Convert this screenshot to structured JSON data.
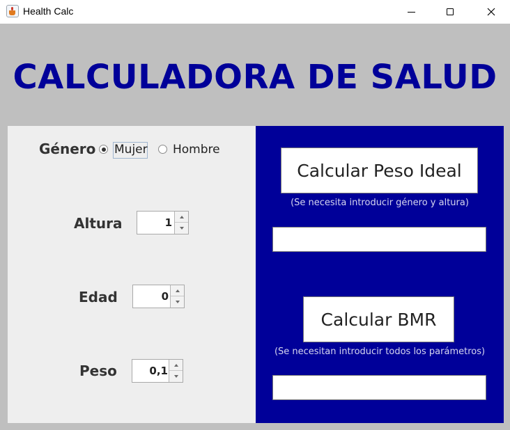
{
  "window": {
    "title": "Health Calc"
  },
  "header": {
    "title": "CALCULADORA DE SALUD"
  },
  "form": {
    "gender_label": "Género",
    "gender_options": [
      "Mujer",
      "Hombre"
    ],
    "gender_selected": "Mujer",
    "height_label": "Altura",
    "height_value": "1",
    "age_label": "Edad",
    "age_value": "0",
    "weight_label": "Peso",
    "weight_value": "0,1"
  },
  "actions": {
    "ideal_weight_button": "Calcular Peso Ideal",
    "ideal_weight_hint": "(Se necesita introducir género y altura)",
    "ideal_weight_result": "",
    "bmr_button": "Calcular BMR",
    "bmr_hint": "(Se necesitan introducir todos los parámetros)",
    "bmr_result": ""
  },
  "colors": {
    "accent": "#000099",
    "background": "#bfbfbf",
    "left_panel": "#eeeeee"
  }
}
